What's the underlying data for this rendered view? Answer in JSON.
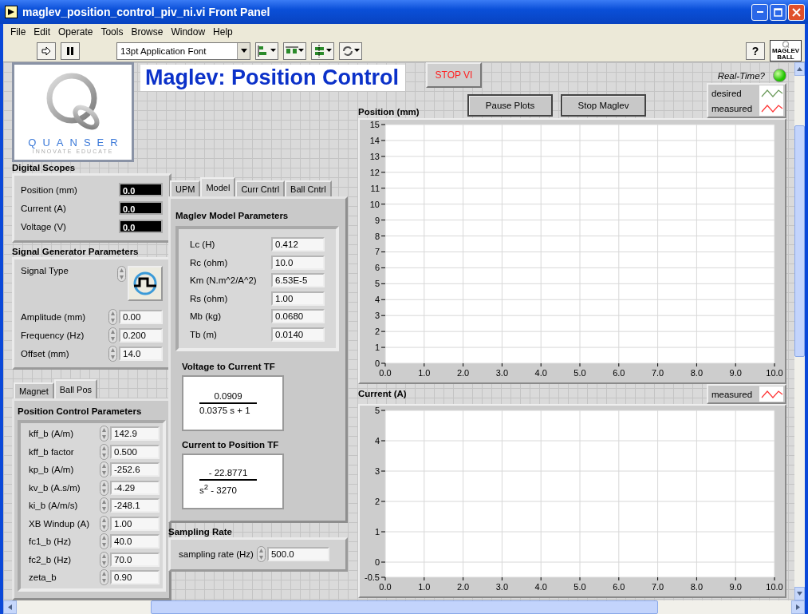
{
  "window": {
    "title": "maglev_position_control_piv_ni.vi Front Panel"
  },
  "menu": [
    "File",
    "Edit",
    "Operate",
    "Tools",
    "Browse",
    "Window",
    "Help"
  ],
  "toolbar": {
    "font": "13pt Application Font",
    "help": "?",
    "vi_icon_text": "MAGLEV BALL"
  },
  "logo": {
    "name": "QUANSER",
    "tagline": "INNOVATE EDUCATE"
  },
  "header": {
    "title": "Maglev: Position Control",
    "stop_button": "STOP VI",
    "realtime": {
      "label": "Real-Time?",
      "on": true
    }
  },
  "digital_scopes": {
    "title": "Digital Scopes",
    "items": [
      {
        "label": "Position (mm)",
        "value": "0.0"
      },
      {
        "label": "Current (A)",
        "value": "0.0"
      },
      {
        "label": "Voltage (V)",
        "value": "0.0"
      }
    ]
  },
  "signal_generator": {
    "title": "Signal Generator Parameters",
    "signal_type_label": "Signal Type",
    "params": [
      {
        "label": "Amplitude (mm)",
        "value": "0.00"
      },
      {
        "label": "Frequency (Hz)",
        "value": "0.200"
      },
      {
        "label": "Offset (mm)",
        "value": "14.0"
      }
    ]
  },
  "left_tabs": [
    {
      "label": "Magnet",
      "selected": false
    },
    {
      "label": "Ball Pos",
      "selected": true
    }
  ],
  "position_control": {
    "title": "Position Control Parameters",
    "params": [
      {
        "label": "kff_b (A/m)",
        "value": "142.9"
      },
      {
        "label": "kff_b factor",
        "value": "0.500"
      },
      {
        "label": "kp_b (A/m)",
        "value": "-252.6"
      },
      {
        "label": "kv_b (A.s/m)",
        "value": "-4.29"
      },
      {
        "label": "ki_b (A/m/s)",
        "value": "-248.1"
      },
      {
        "label": "XB Windup (A)",
        "value": "1.00"
      },
      {
        "label": "fc1_b (Hz)",
        "value": "40.0"
      },
      {
        "label": "fc2_b (Hz)",
        "value": "70.0"
      },
      {
        "label": "zeta_b",
        "value": "0.90"
      }
    ]
  },
  "model_tabs": [
    {
      "label": "UPM",
      "selected": false
    },
    {
      "label": "Model",
      "selected": true
    },
    {
      "label": "Curr Cntrl",
      "selected": false
    },
    {
      "label": "Ball Cntrl",
      "selected": false
    }
  ],
  "model": {
    "title": "Maglev Model Parameters",
    "params": [
      {
        "label": "Lc (H)",
        "value": "0.412"
      },
      {
        "label": "Rc (ohm)",
        "value": "10.0"
      },
      {
        "label": "Km (N.m^2/A^2)",
        "value": "6.53E-5"
      },
      {
        "label": "Rs (ohm)",
        "value": "1.00"
      },
      {
        "label": "Mb (kg)",
        "value": "0.0680"
      },
      {
        "label": "Tb (m)",
        "value": "0.0140"
      }
    ],
    "transfer_functions": [
      {
        "title": "Voltage to Current TF",
        "numerator": "0.0909",
        "denominator": "0.0375 s + 1"
      },
      {
        "title": "Current to Position TF",
        "numerator": "- 22.8771",
        "denominator": "s$^{2}$ - 3270"
      }
    ]
  },
  "sampling": {
    "title": "Sampling Rate",
    "label": "sampling rate (Hz)",
    "value": "500.0"
  },
  "plot_buttons": [
    "Pause Plots",
    "Stop Maglev"
  ],
  "position_chart": {
    "title": "Position (mm)",
    "chart_data": {
      "type": "line",
      "ylim": [
        0,
        15
      ],
      "categories": [
        "0.0",
        "1.0",
        "2.0",
        "3.0",
        "4.0",
        "5.0",
        "6.0",
        "7.0",
        "8.0",
        "9.0",
        "10.0"
      ],
      "grid": true,
      "yticks": [
        0,
        1,
        2,
        3,
        4,
        5,
        6,
        7,
        8,
        9,
        10,
        11,
        12,
        13,
        14,
        15
      ],
      "series": [
        {
          "name": "desired",
          "color": "#6b9a5a",
          "values": [
            null,
            null,
            null,
            null,
            null,
            null,
            null,
            null,
            null,
            null,
            null
          ]
        },
        {
          "name": "measured",
          "color": "#ff3333",
          "values": [
            null,
            null,
            null,
            null,
            null,
            null,
            null,
            null,
            null,
            null,
            null
          ]
        }
      ]
    }
  },
  "current_chart": {
    "title": "Current (A)",
    "chart_data": {
      "type": "line",
      "ylim": [
        -0.5,
        5
      ],
      "categories": [
        "0.0",
        "1.0",
        "2.0",
        "3.0",
        "4.0",
        "5.0",
        "6.0",
        "7.0",
        "8.0",
        "9.0",
        "10.0"
      ],
      "grid": true,
      "yticks": [
        -0.5,
        0,
        1,
        2,
        3,
        4,
        5
      ],
      "series": [
        {
          "name": "measured",
          "color": "#ff3333",
          "values": [
            null,
            null,
            null,
            null,
            null,
            null,
            null,
            null,
            null,
            null,
            null
          ]
        }
      ]
    }
  }
}
